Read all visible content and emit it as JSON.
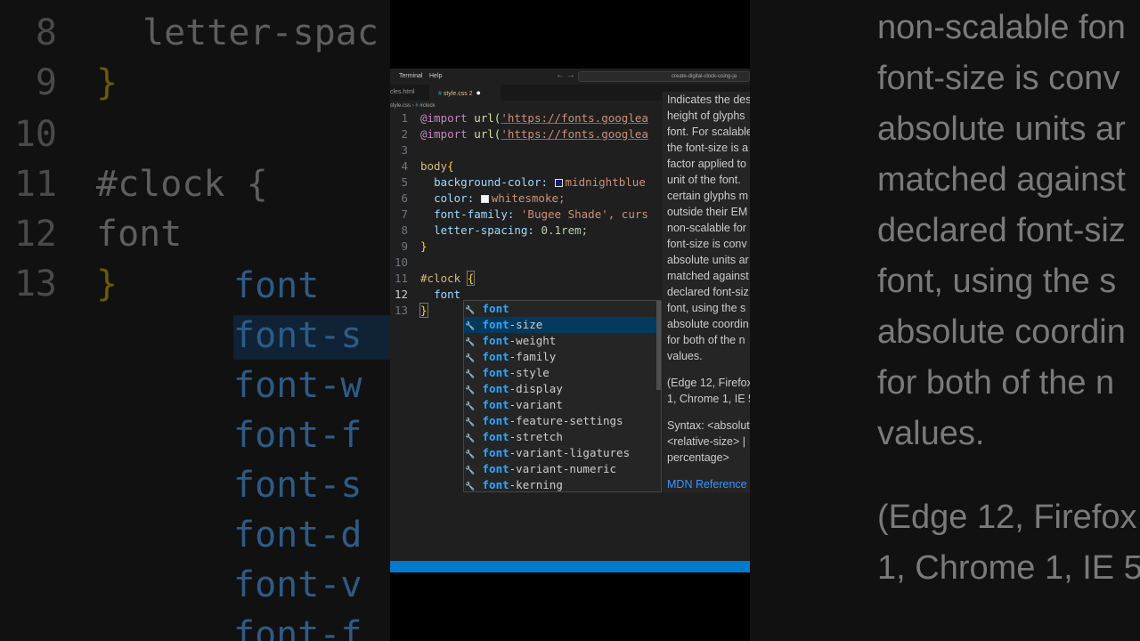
{
  "titlebar": {
    "menu_terminal": "Terminal",
    "menu_help": "Help",
    "nav_back": "←",
    "nav_forward": "→",
    "search_text": "create-digital-clock-using-ja"
  },
  "tabs": {
    "tab1": "cles.html",
    "tab2": "style.css",
    "tab2_badge": "2"
  },
  "breadcrumbs": {
    "file": "style.css",
    "symbol": "#clock"
  },
  "editor": {
    "line_numbers": [
      "1",
      "2",
      "3",
      "4",
      "5",
      "6",
      "7",
      "8",
      "9",
      "10",
      "11",
      "12",
      "13"
    ],
    "l1_kw": "@import",
    "l1_fn": "url(",
    "l1_str": "'https://fonts.googlea",
    "l2_kw": "@import",
    "l2_fn": "url(",
    "l2_str": "'https://fonts.googlea",
    "l4_sel": "body",
    "l4_brace": "{",
    "l5_prop": "background-color:",
    "l5_val": "midnightblue",
    "l6_prop": "color:",
    "l6_val": "whitesmoke;",
    "l7_prop": "font-family:",
    "l7_val": "'Bugee Shade', curs",
    "l8_prop": "letter-spacing:",
    "l8_val": "0.1rem;",
    "l9_brace": "}",
    "l11_sel": "#clock",
    "l11_brace": "{",
    "l12_typed": "font",
    "l13_brace": "}"
  },
  "colors": {
    "midnightblue": "#191970",
    "whitesmoke": "#f5f5f5",
    "accent": "#007acc"
  },
  "suggest": {
    "match": "font",
    "selected_index": 1,
    "items": [
      {
        "match": "font",
        "rest": ""
      },
      {
        "match": "font",
        "rest": "-size"
      },
      {
        "match": "font",
        "rest": "-weight"
      },
      {
        "match": "font",
        "rest": "-family"
      },
      {
        "match": "font",
        "rest": "-style"
      },
      {
        "match": "font",
        "rest": "-display"
      },
      {
        "match": "font",
        "rest": "-variant"
      },
      {
        "match": "font",
        "rest": "-feature-settings"
      },
      {
        "match": "font",
        "rest": "-stretch"
      },
      {
        "match": "font",
        "rest": "-variant-ligatures"
      },
      {
        "match": "font",
        "rest": "-variant-numeric"
      },
      {
        "match": "font",
        "rest": "-kerning"
      }
    ],
    "icon_name": "wrench-icon",
    "icon_glyph": "🔧"
  },
  "doc": {
    "lines": [
      "Indicates the des",
      "height of glyphs",
      "font. For scalable",
      "the font-size is a",
      "factor applied to",
      "unit of the font.",
      "certain glyphs m",
      "outside their EM",
      "non-scalable for",
      "font-size is conv",
      "absolute units ar",
      "matched against",
      "declared font-siz",
      "font, using the s",
      "absolute coordin",
      "for both of the n",
      "values.",
      "",
      "(Edge 12, Firefox",
      "1, Chrome 1, IE 5",
      "",
      "Syntax: <absolut",
      "<relative-size> |",
      "percentage>"
    ],
    "link": "MDN Reference"
  },
  "bg_left": {
    "lines": [
      {
        "num": "8",
        "text": "letter-spac"
      },
      {
        "num": "9",
        "text": "}"
      },
      {
        "num": "10",
        "text": ""
      },
      {
        "num": "11",
        "text": "#clock {"
      },
      {
        "num": "12",
        "text": "  font"
      },
      {
        "num": "13",
        "text": "}"
      }
    ],
    "suggestions": [
      "font",
      "font-s",
      "font-w",
      "font-f",
      "font-s",
      "font-d",
      "font-v",
      "font-f"
    ]
  },
  "bg_right": {
    "lines": [
      "non-scalable fon",
      "font-size is conv",
      "absolute units ar",
      "matched against",
      "declared font-siz",
      "font, using the s",
      "absolute coordin",
      "for both of the n",
      "values.",
      "",
      "(Edge 12, Firefox",
      "1, Chrome 1, IE 5"
    ]
  }
}
